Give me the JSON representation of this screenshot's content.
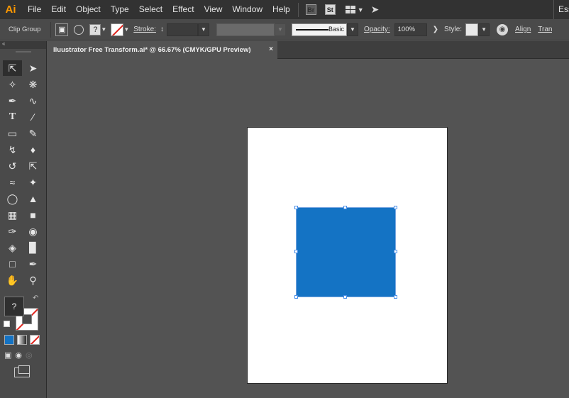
{
  "app": {
    "logo": "Ai",
    "workspace_label": "Essentials"
  },
  "menu": [
    "File",
    "Edit",
    "Object",
    "Type",
    "Select",
    "Effect",
    "View",
    "Window",
    "Help"
  ],
  "menubar_icons": {
    "bridge": "Br",
    "stock": "St"
  },
  "control_bar": {
    "selection_label": "Clip Group",
    "fill_swatch": "?",
    "stroke_label": "Stroke:",
    "brush_label": "Basic",
    "opacity_label": "Opacity:",
    "opacity_value": "100%",
    "style_label": "Style:",
    "align_label": "Align",
    "transform_label": "Transform"
  },
  "document_tab": {
    "title": "Iluustrator Free Transform.ai* @ 66.67% (CMYK/GPU Preview)",
    "close_glyph": "×"
  },
  "tools_panel": {
    "fill_swatch_glyph": "?"
  },
  "colors": {
    "accent_blue": "#1473c4",
    "none_red": "#e0231c",
    "logo_orange": "#ff9a00",
    "artboard": "#ffffff",
    "canvas": "#535353"
  }
}
